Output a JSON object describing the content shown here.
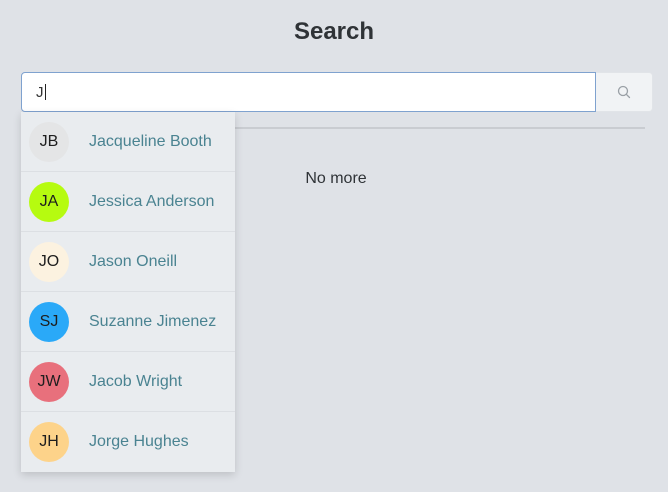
{
  "page": {
    "title": "Search"
  },
  "search": {
    "value": "J",
    "button_icon": "search-icon"
  },
  "results": {
    "empty_text": "No more"
  },
  "suggestions": [
    {
      "initials": "JB",
      "name": "Jacqueline Booth",
      "color": "#e4e5e6"
    },
    {
      "initials": "JA",
      "name": "Jessica Anderson",
      "color": "#b6fb10"
    },
    {
      "initials": "JO",
      "name": "Jason Oneill",
      "color": "#fcf2e0"
    },
    {
      "initials": "SJ",
      "name": "Suzanne Jimenez",
      "color": "#2aa9f8"
    },
    {
      "initials": "JW",
      "name": "Jacob Wright",
      "color": "#e8707c"
    },
    {
      "initials": "JH",
      "name": "Jorge Hughes",
      "color": "#fdd38a"
    }
  ]
}
